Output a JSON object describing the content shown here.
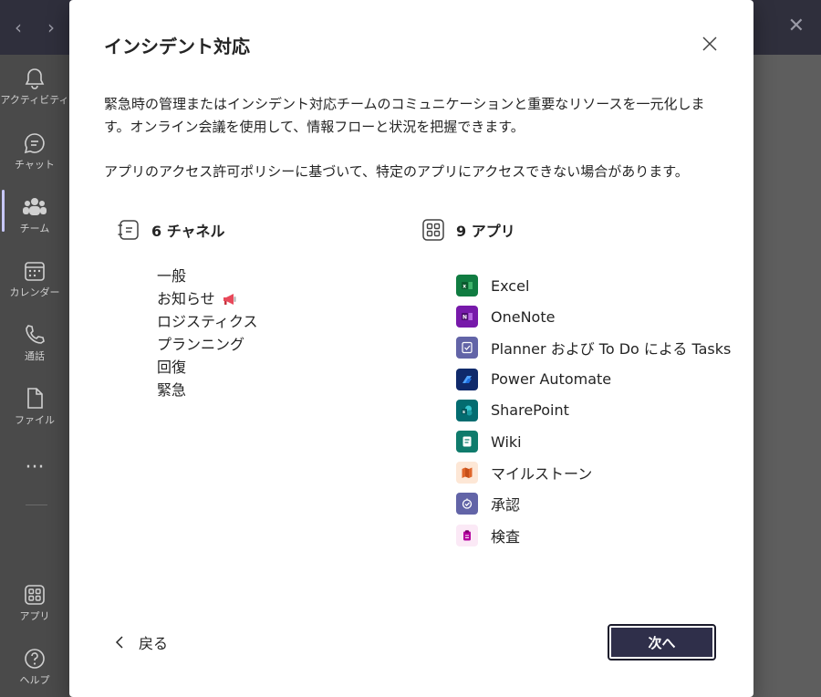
{
  "dialog": {
    "title": "インシデント対応",
    "description": "緊急時の管理またはインシデント対応チームのコミュニケーションと重要なリソースを一元化します。オンライン会議を使用して、情報フローと状況を把握できます。",
    "note": "アプリのアクセス許可ポリシーに基づいて、特定のアプリにアクセスできない場合があります。",
    "channels": {
      "heading": "6 チャネル",
      "items": [
        "一般",
        "お知らせ",
        "ロジスティクス",
        "プランニング",
        "回復",
        "緊急"
      ]
    },
    "apps": {
      "heading": "9 アプリ",
      "items": [
        {
          "label": "Excel",
          "icon": "excel-icon",
          "color": "#107c41"
        },
        {
          "label": "OneNote",
          "icon": "onenote-icon",
          "color": "#7719aa"
        },
        {
          "label": "Planner および To Do による Tasks",
          "icon": "tasks-icon",
          "color": "#6264a7"
        },
        {
          "label": "Power Automate",
          "icon": "power-automate-icon",
          "color": "#0f2a6b"
        },
        {
          "label": "SharePoint",
          "icon": "sharepoint-icon",
          "color": "#036c70"
        },
        {
          "label": "Wiki",
          "icon": "wiki-icon",
          "color": "#0f7b6c"
        },
        {
          "label": "マイルストーン",
          "icon": "milestones-icon",
          "color": "#fde7d6"
        },
        {
          "label": "承認",
          "icon": "approvals-icon",
          "color": "#6264a7"
        },
        {
          "label": "検査",
          "icon": "inspection-icon",
          "color": "#fbe9f6"
        }
      ]
    },
    "back_label": "戻る",
    "next_label": "次へ"
  },
  "rail": {
    "items": [
      {
        "label": "アクティビティ",
        "icon": "bell-icon"
      },
      {
        "label": "チャット",
        "icon": "chat-icon"
      },
      {
        "label": "チーム",
        "icon": "teams-icon"
      },
      {
        "label": "カレンダー",
        "icon": "calendar-icon"
      },
      {
        "label": "通話",
        "icon": "phone-icon"
      },
      {
        "label": "ファイル",
        "icon": "file-icon"
      },
      {
        "label": "アプリ",
        "icon": "apps-icon"
      },
      {
        "label": "ヘルプ",
        "icon": "help-icon"
      }
    ]
  }
}
